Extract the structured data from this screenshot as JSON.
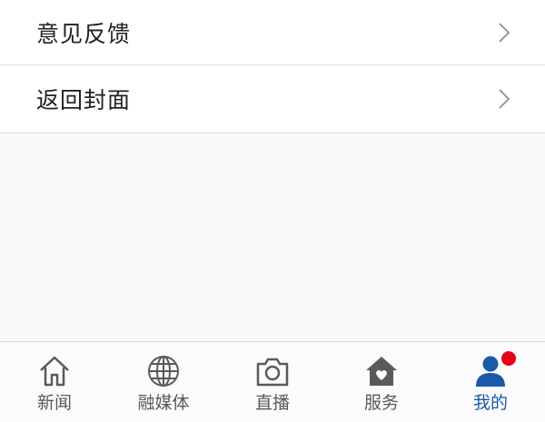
{
  "menu": {
    "items": [
      {
        "label": "意见反馈"
      },
      {
        "label": "返回封面"
      }
    ]
  },
  "tabbar": {
    "tabs": [
      {
        "label": "新闻",
        "icon": "home-icon"
      },
      {
        "label": "融媒体",
        "icon": "globe-icon"
      },
      {
        "label": "直播",
        "icon": "camera-icon"
      },
      {
        "label": "服务",
        "icon": "house-heart-icon"
      },
      {
        "label": "我的",
        "icon": "user-icon",
        "active": true,
        "badge": true
      }
    ]
  },
  "colors": {
    "active": "#1a5aa8",
    "inactive": "#5a5a5a",
    "badge": "#e60012"
  }
}
